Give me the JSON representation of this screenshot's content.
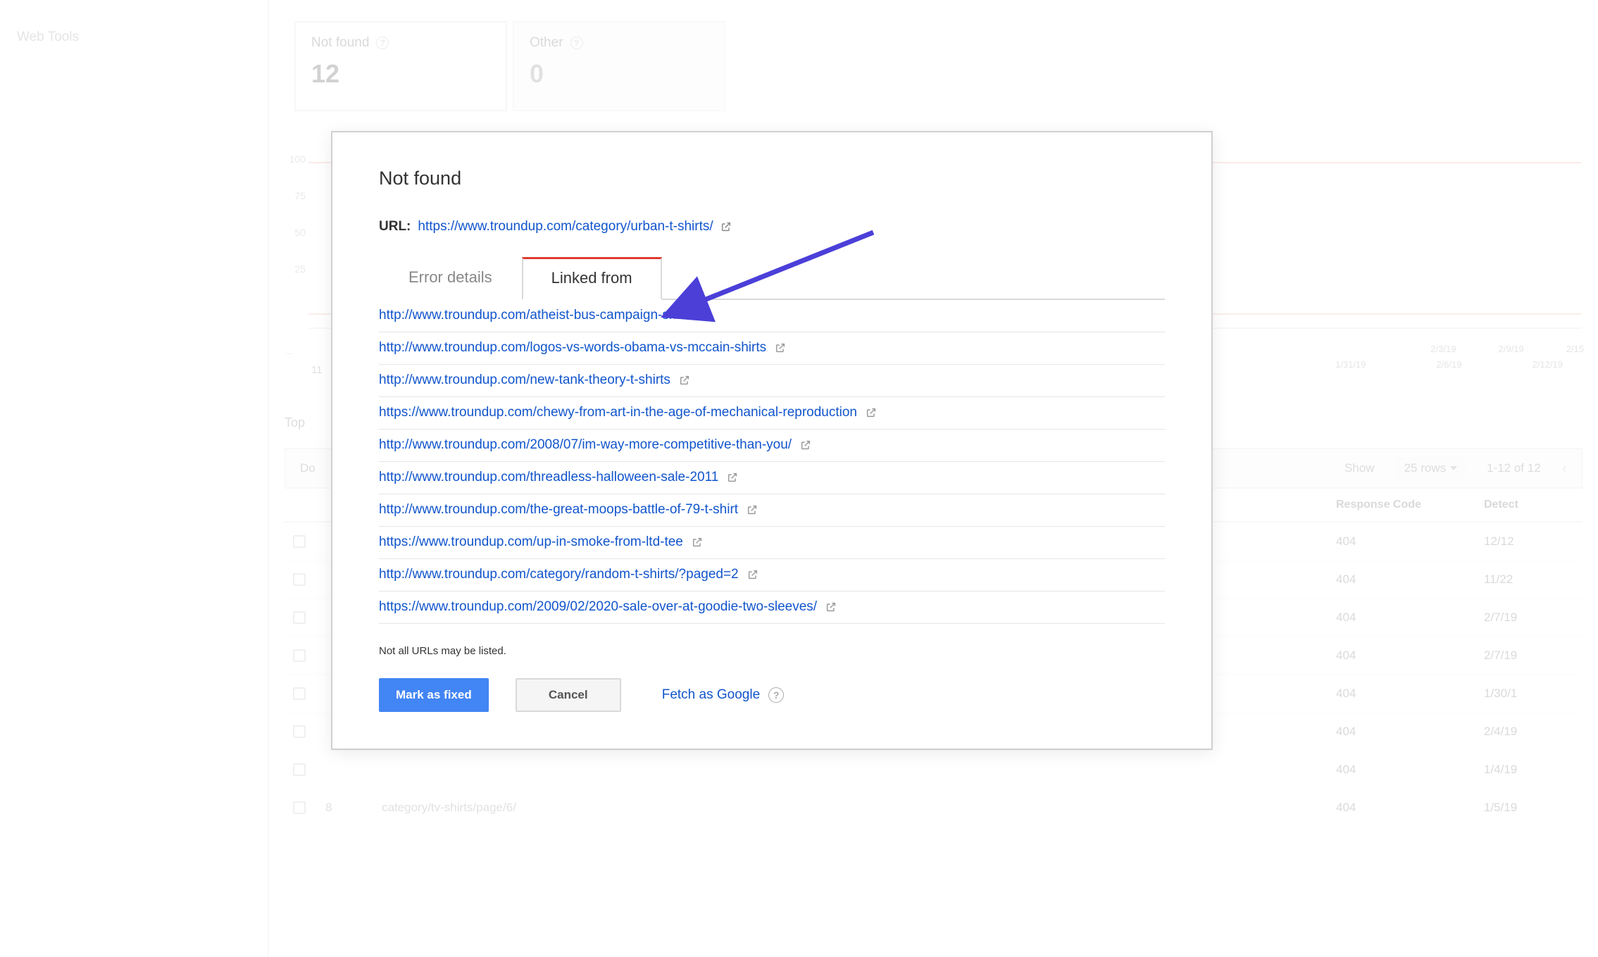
{
  "sidebar": {
    "webtools_label": "Web Tools"
  },
  "cards": {
    "notfound": {
      "title": "Not found",
      "count": "12"
    },
    "other": {
      "title": "Other",
      "count": "0"
    }
  },
  "chart_data": {
    "type": "line",
    "y_ticks": [
      "100",
      "75",
      "50",
      "25"
    ],
    "x_ticks_top": [
      "2/3/19",
      "2/9/19",
      "2/15"
    ],
    "x_ticks_bottom": [
      "1/31/19",
      "2/6/19",
      "2/12/19"
    ],
    "ylabel_left_dots": "..."
  },
  "section": {
    "top_label": "Top",
    "do_label": "Do",
    "rows_selector": "25 rows",
    "page_range": "1-12 of 12"
  },
  "columns": {
    "response": "Response Code",
    "detected": "Detect"
  },
  "rows": [
    {
      "priority": "",
      "url": "",
      "code": "404",
      "detected": "12/12"
    },
    {
      "priority": "",
      "url": "",
      "code": "404",
      "detected": "11/22"
    },
    {
      "priority": "",
      "url": "",
      "code": "404",
      "detected": "2/7/19"
    },
    {
      "priority": "",
      "url": "",
      "code": "404",
      "detected": "2/7/19"
    },
    {
      "priority": "",
      "url": "",
      "code": "404",
      "detected": "1/30/1"
    },
    {
      "priority": "",
      "url": "",
      "code": "404",
      "detected": "2/4/19"
    },
    {
      "priority": "",
      "url": "",
      "code": "404",
      "detected": "1/4/19"
    },
    {
      "priority": "8",
      "url": "category/tv-shirts/page/6/",
      "code": "404",
      "detected": "1/5/19"
    }
  ],
  "starting_row_number": "11",
  "modal": {
    "title": "Not found",
    "url_label": "URL:",
    "url_value": "https://www.troundup.com/category/urban-t-shirts/",
    "tabs": {
      "error_details": "Error details",
      "linked_from": "Linked from"
    },
    "links": [
      "http://www.troundup.com/atheist-bus-campaign-shirt",
      "http://www.troundup.com/logos-vs-words-obama-vs-mccain-shirts",
      "http://www.troundup.com/new-tank-theory-t-shirts",
      "https://www.troundup.com/chewy-from-art-in-the-age-of-mechanical-reproduction",
      "http://www.troundup.com/2008/07/im-way-more-competitive-than-you/",
      "http://www.troundup.com/threadless-halloween-sale-2011",
      "http://www.troundup.com/the-great-moops-battle-of-79-t-shirt",
      "https://www.troundup.com/up-in-smoke-from-ltd-tee",
      "http://www.troundup.com/category/random-t-shirts/?paged=2",
      "https://www.troundup.com/2009/02/2020-sale-over-at-goodie-two-sleeves/"
    ],
    "note": "Not all URLs may be listed.",
    "buttons": {
      "mark_fixed": "Mark as fixed",
      "cancel": "Cancel",
      "fetch": "Fetch as Google"
    }
  }
}
